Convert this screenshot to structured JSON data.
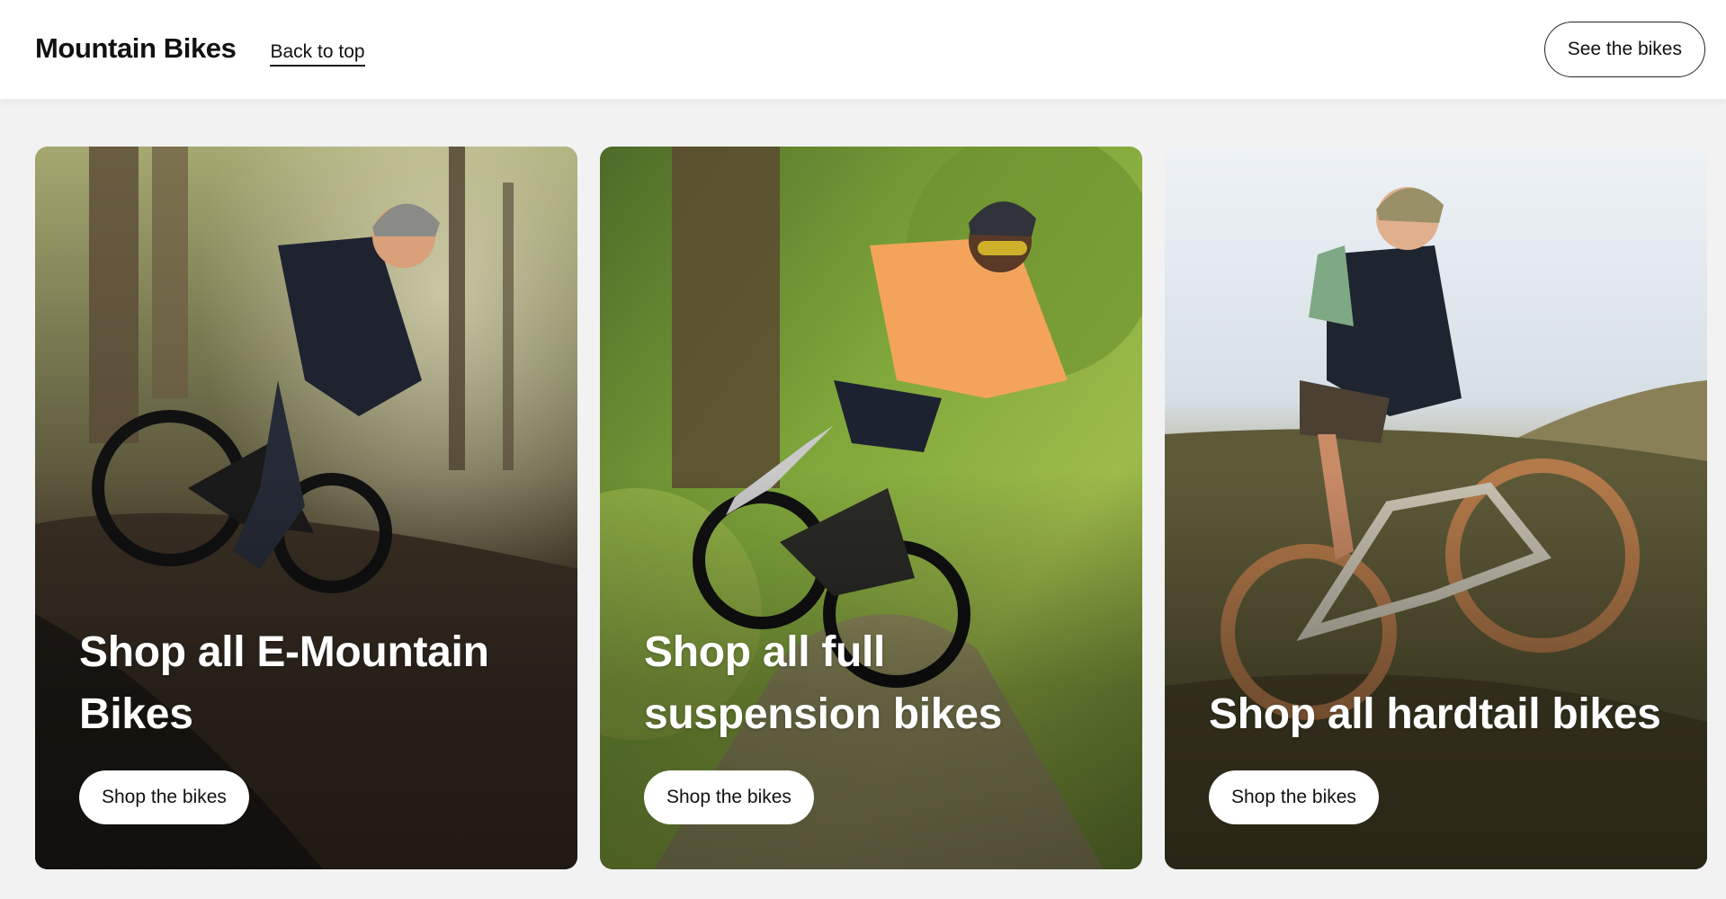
{
  "header": {
    "title": "Mountain Bikes",
    "back_link": "Back to top",
    "see_button": "See the bikes"
  },
  "cards": [
    {
      "heading": "Shop all E-Mountain Bikes",
      "button": "Shop the bikes",
      "image_subject": "rider on black e-mountain bike in dark forest trail"
    },
    {
      "heading": "Shop all full suspension bikes",
      "button": "Shop the bikes",
      "image_subject": "rider in orange shirt on full suspension bike on green trail"
    },
    {
      "heading": "Shop all hardtail bikes",
      "button": "Shop the bikes",
      "image_subject": "rider on hardtail bike on grassy hillside"
    }
  ],
  "colors": {
    "page_background": "#f2f2f2",
    "header_background": "#ffffff",
    "card_text": "#ffffff",
    "button_background": "#ffffff"
  }
}
